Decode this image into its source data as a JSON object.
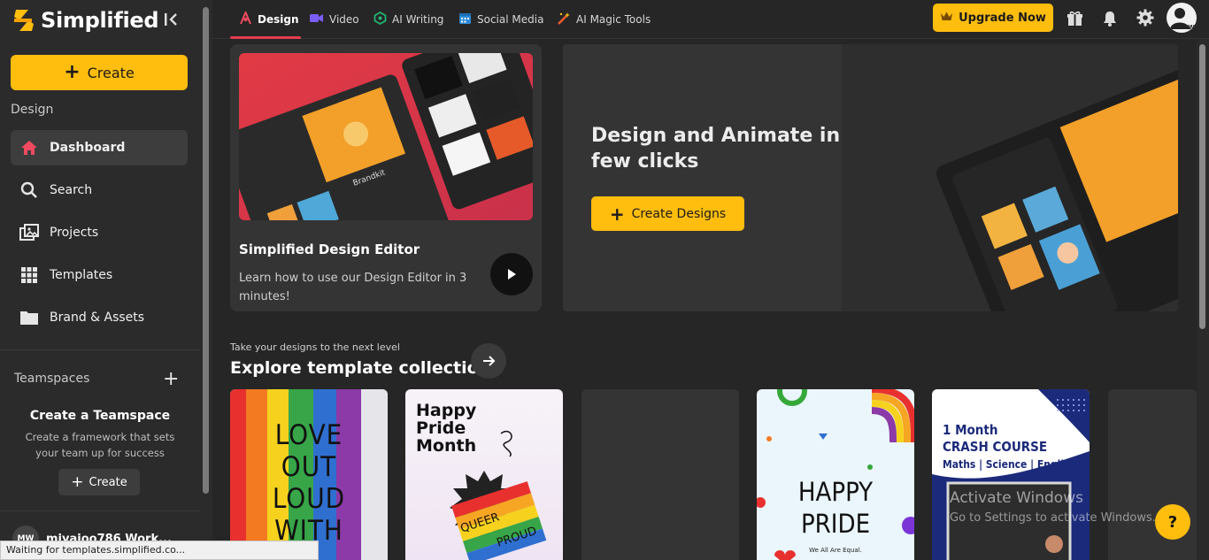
{
  "brand": {
    "name": "Simplified",
    "collapse_glyph": "I‹"
  },
  "sidebar": {
    "create_label": "Create",
    "section_label": "Design",
    "items": [
      {
        "label": "Dashboard",
        "icon": "home-icon",
        "active": true
      },
      {
        "label": "Search",
        "icon": "search-icon"
      },
      {
        "label": "Projects",
        "icon": "projects-icon"
      },
      {
        "label": "Templates",
        "icon": "grid-icon"
      },
      {
        "label": "Brand & Assets",
        "icon": "folder-icon"
      }
    ],
    "teamspaces_label": "Teamspaces",
    "teamspace_title": "Create a Teamspace",
    "teamspace_desc": "Create a framework that sets your team up for success",
    "teamspace_create": "Create",
    "workspace_name": "miyajoo786 Work...",
    "workspace_initials": "MW"
  },
  "status_bar": "Waiting for templates.simplified.co...",
  "topbar": {
    "tabs": [
      {
        "label": "Design",
        "icon": "design-icon",
        "active": true
      },
      {
        "label": "Video",
        "icon": "video-icon"
      },
      {
        "label": "AI Writing",
        "icon": "ai-writing-icon"
      },
      {
        "label": "Social Media",
        "icon": "calendar-icon"
      },
      {
        "label": "AI Magic Tools",
        "icon": "magic-wand-icon"
      }
    ],
    "upgrade_label": "Upgrade Now",
    "avatar_initials": "MW"
  },
  "editor_card": {
    "title": "Simplified Design Editor",
    "description": "Learn how to use our Design Editor in 3 minutes!",
    "thumb_brandkit": "Brandkit"
  },
  "hero": {
    "title": "Design and Animate in few clicks",
    "button_label": "Create Designs"
  },
  "explore": {
    "subtitle": "Take your designs to the next level",
    "title": "Explore template collection"
  },
  "templates": [
    {
      "lines": [
        "LOVE",
        "OUT",
        "LOUD",
        "WITH"
      ]
    },
    {
      "lines": [
        "Happy",
        "Pride",
        "Month"
      ],
      "badge": [
        "QUEER",
        "PROUD"
      ]
    },
    {
      "lines": []
    },
    {
      "lines": [
        "HAPPY",
        "PRIDE"
      ],
      "footer": "We All Are Equal."
    },
    {
      "lines": [
        "1 Month",
        "CRASH COURSE",
        "Maths | Science | English"
      ]
    }
  ],
  "watermark": {
    "title": "Activate Windows",
    "sub": "Go to Settings to activate Windows."
  },
  "help_label": "?",
  "colors": {
    "accent": "#ffbd0e",
    "active_tab": "#e53d50",
    "background": "#262626",
    "panel": "#343434"
  }
}
